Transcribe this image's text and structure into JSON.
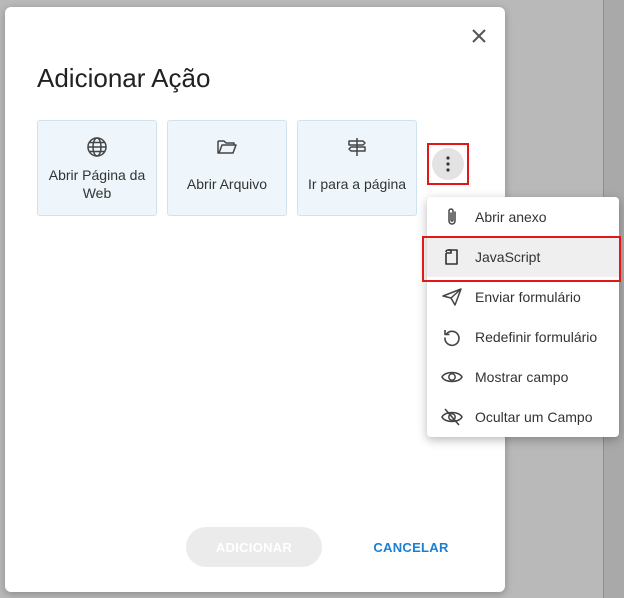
{
  "dialog": {
    "title": "Adicionar Ação",
    "close_icon": "close-icon"
  },
  "actions": [
    {
      "label": "Abrir Página da Web",
      "icon": "globe-icon"
    },
    {
      "label": "Abrir Arquivo",
      "icon": "folder-open-icon"
    },
    {
      "label": "Ir para a página",
      "icon": "signpost-icon"
    }
  ],
  "more_button": {
    "icon": "more-vertical-icon"
  },
  "menu": {
    "items": [
      {
        "label": "Abrir anexo",
        "icon": "paperclip-icon"
      },
      {
        "label": "JavaScript",
        "icon": "javascript-icon"
      },
      {
        "label": "Enviar formulário",
        "icon": "send-icon"
      },
      {
        "label": "Redefinir formulário",
        "icon": "reset-icon"
      },
      {
        "label": "Mostrar campo",
        "icon": "eye-icon"
      },
      {
        "label": "Ocultar um Campo",
        "icon": "eye-off-icon"
      }
    ]
  },
  "footer": {
    "add_label": "ADICIONAR",
    "cancel_label": "CANCELAR"
  },
  "colors": {
    "accent": "#1a7fd1",
    "highlight": "#e01818",
    "card_bg": "#eef6fb"
  }
}
